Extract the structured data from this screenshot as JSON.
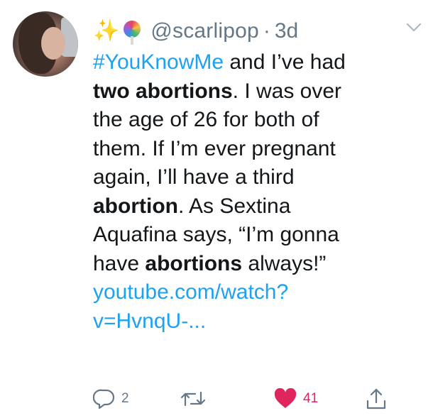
{
  "tweet": {
    "header": {
      "emoji_1": "✨",
      "emoji_2": "lollipop",
      "handle": "@scarlipop",
      "separator": "·",
      "time": "3d"
    },
    "text": {
      "hashtag": "#YouKnowMe",
      "l1_rest": " and I’ve had",
      "l2_bold": "two abortions",
      "l2_rest": ". I was over",
      "l3": "the age of 26 for both of",
      "l4": "them. If I’m ever pregnant",
      "l5": "again, I’ll have a third",
      "l6_bold": "abortion",
      "l6_rest": ". As Sextina",
      "l7": "Aquafina says, “I’m gonna",
      "l8_pre": "have ",
      "l8_bold": "abortions",
      "l8_rest": " always!”",
      "link_1": "youtube.com/watch?",
      "link_2": "v=HvnqU-..."
    },
    "actions": {
      "reply_count": "2",
      "retweet_count": "",
      "like_count": "41",
      "liked": true
    },
    "icons": {
      "reply": "reply-icon",
      "retweet": "retweet-icon",
      "like": "heart-icon",
      "share": "share-icon",
      "caret": "chevron-down-icon"
    },
    "colors": {
      "link": "#1da1f2",
      "muted": "#657786",
      "like": "#e0245e",
      "text": "#14171a"
    }
  }
}
